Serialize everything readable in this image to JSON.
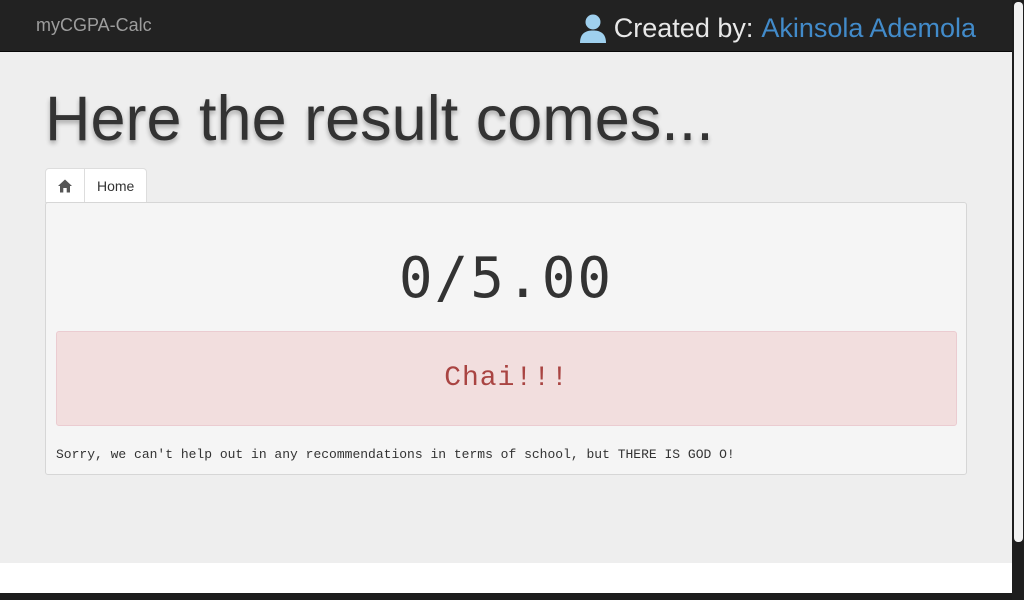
{
  "navbar": {
    "brand": "myCGPA-Calc",
    "created_by_label": "Created by:",
    "author_name": "Akinsola Ademola",
    "user_icon": "user-icon"
  },
  "page": {
    "title": "Here the result comes..."
  },
  "tabs": [
    {
      "icon": "home-icon"
    },
    {
      "label": "Home"
    }
  ],
  "result": {
    "score": "0/5.00",
    "alert": "Chai!!!",
    "note": "Sorry, we can't help out in any recommendations in terms of school, but THERE IS GOD O!"
  },
  "colors": {
    "navbar_bg": "#222222",
    "link": "#428bca",
    "alert_bg": "#f2dede",
    "alert_text": "#a94442"
  }
}
